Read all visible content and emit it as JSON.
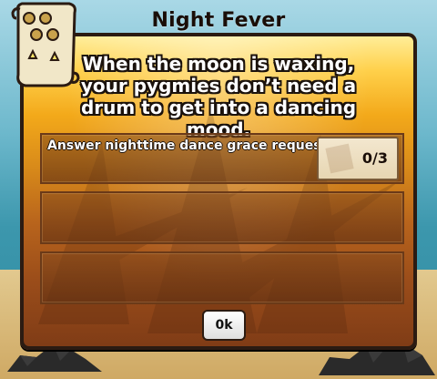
{
  "popup": {
    "title": "Night Fever",
    "description": "When the moon is waxing, your pygmies don’t need a drum to get into a dancing mood.",
    "requests": [
      {
        "text": "Answer nighttime dance grace requests.",
        "progress": "0/3"
      },
      {
        "text": "",
        "progress": ""
      },
      {
        "text": "",
        "progress": ""
      }
    ],
    "ok_label": "0k"
  },
  "colors": {
    "panel_top": "#ffd04a",
    "panel_bottom": "#7e3b16",
    "border": "#2b1b12",
    "text_white": "#ffffff"
  }
}
